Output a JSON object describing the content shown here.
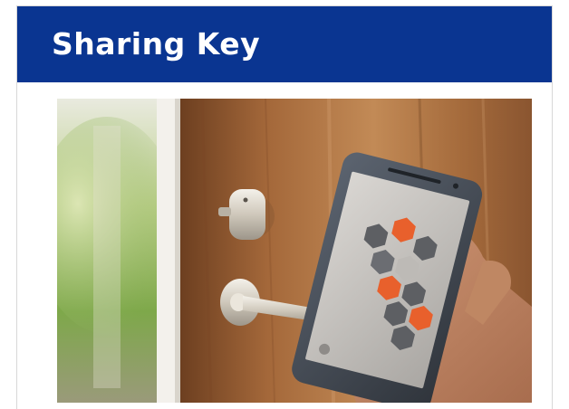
{
  "header": {
    "title": "Sharing Key"
  },
  "photo": {
    "description_icon": "smart-lock-photo"
  },
  "colors": {
    "header_bg": "#0a3591",
    "header_text": "#ffffff",
    "accent_orange": "#e8602c"
  }
}
